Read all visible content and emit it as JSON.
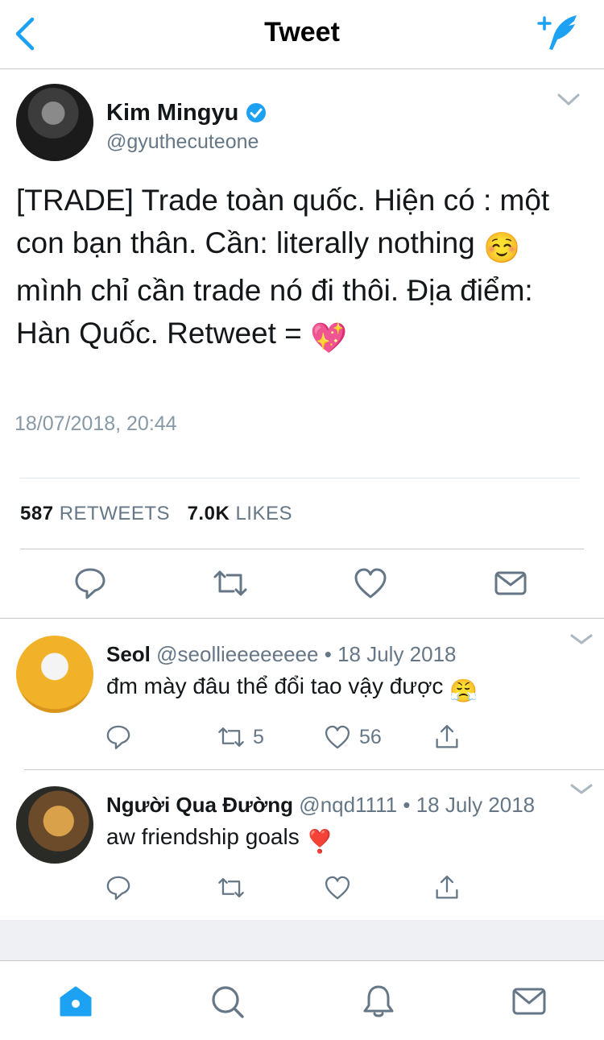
{
  "header": {
    "title": "Tweet",
    "back_icon": "back-chevron-icon",
    "compose_icon": "compose-feather-icon",
    "accent_color": "#1da1f2"
  },
  "tweet": {
    "author_name": "Kim Mingyu",
    "author_handle": "@gyuthecuteone",
    "verified": true,
    "text_part1": "[TRADE] Trade toàn quốc. Hiện có : một con bạn thân. Cần: literally nothing ",
    "emoji1": "☺️",
    "text_part2": " mình chỉ cần trade nó đi thôi. Địa điểm: Hàn Quốc. Retweet = ",
    "emoji2": "💖",
    "timestamp": "18/07/2018, 20:44",
    "retweets_count": "587",
    "retweets_label": "RETWEETS",
    "likes_count": "7.0K",
    "likes_label": "LIKES",
    "actions": [
      "reply-icon",
      "retweet-icon",
      "like-icon",
      "message-icon"
    ]
  },
  "replies": [
    {
      "name": "Seol",
      "handle": "@seollieeeeeeee",
      "separator": "•",
      "date": "18 July 2018",
      "text": "đm mày đâu thể đổi tao vậy được ",
      "emoji": "😤",
      "retweets": "5",
      "likes": "56"
    },
    {
      "name": "Người Qua Đường",
      "handle": "@nqd1111",
      "separator": "•",
      "date": "18 July 2018",
      "text": "aw friendship goals ",
      "emoji": "❣️",
      "retweets": "",
      "likes": ""
    }
  ],
  "tabbar": {
    "items": [
      "home-icon",
      "search-icon",
      "notifications-icon",
      "messages-icon"
    ],
    "active_color": "#1da1f2"
  }
}
